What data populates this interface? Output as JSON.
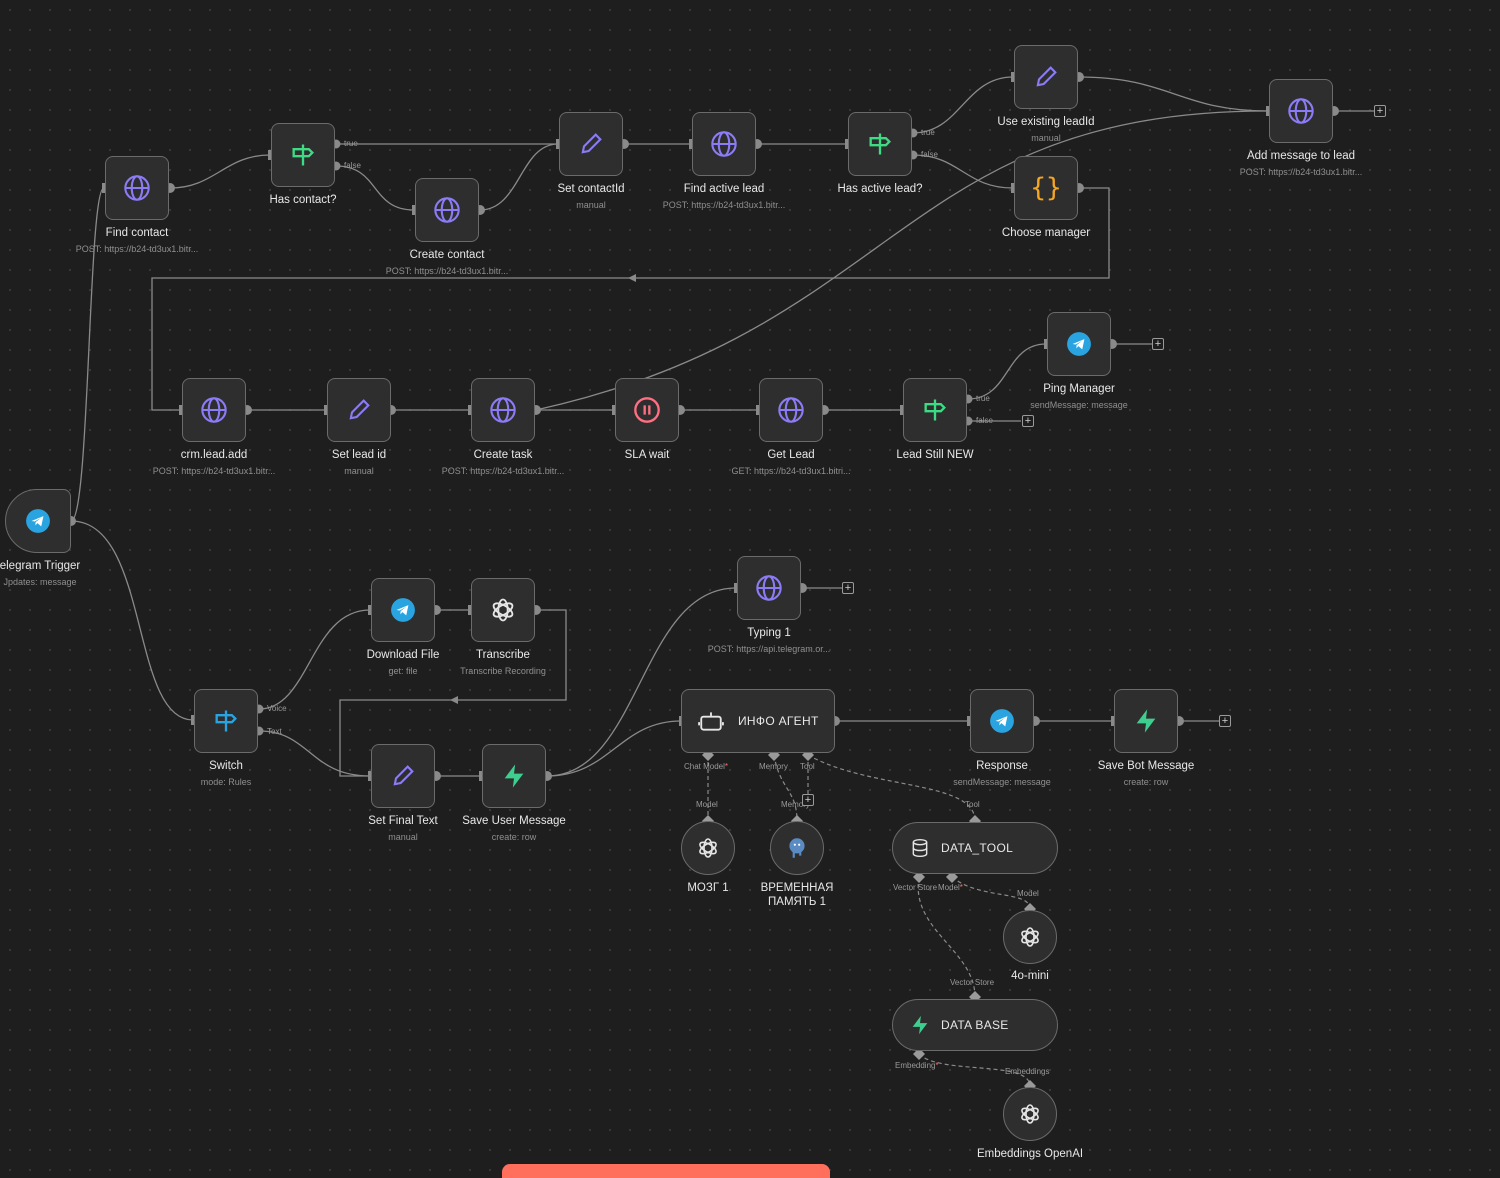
{
  "nodes": {
    "find_contact": {
      "label": "Find contact",
      "sub": "POST: https://b24-td3ux1.bitr...",
      "icon": "globe-icon"
    },
    "has_contact": {
      "label": "Has contact?",
      "icon": "signpost-icon"
    },
    "create_contact": {
      "label": "Create contact",
      "sub": "POST: https://b24-td3ux1.bitr...",
      "icon": "globe-icon"
    },
    "set_contact_id": {
      "label": "Set contactId",
      "sub": "manual",
      "icon": "pencil-icon"
    },
    "find_active_lead": {
      "label": "Find active lead",
      "sub": "POST: https://b24-td3ux1.bitr...",
      "icon": "globe-icon"
    },
    "has_active_lead": {
      "label": "Has active lead?",
      "icon": "signpost-icon"
    },
    "use_existing_lead": {
      "label": "Use existing leadId",
      "sub": "manual",
      "icon": "pencil-icon"
    },
    "choose_manager": {
      "label": "Choose manager",
      "icon": "braces-icon"
    },
    "add_message_lead": {
      "label": "Add message to lead",
      "sub": "POST: https://b24-td3ux1.bitr...",
      "icon": "globe-icon"
    },
    "crm_lead_add": {
      "label": "crm.lead.add",
      "sub": "POST: https://b24-td3ux1.bitr...",
      "icon": "globe-icon"
    },
    "set_lead_id": {
      "label": "Set lead id",
      "sub": "manual",
      "icon": "pencil-icon"
    },
    "create_task": {
      "label": "Create task",
      "sub": "POST: https://b24-td3ux1.bitr...",
      "icon": "globe-icon"
    },
    "sla_wait": {
      "label": "SLA wait",
      "icon": "pause-icon"
    },
    "get_lead": {
      "label": "Get Lead",
      "sub": "GET: https://b24-td3ux1.bitri...",
      "icon": "globe-icon"
    },
    "lead_still_new": {
      "label": "Lead Still NEW",
      "icon": "signpost-icon"
    },
    "ping_manager": {
      "label": "Ping Manager",
      "sub": "sendMessage: message",
      "icon": "telegram-icon"
    },
    "telegram_trigger": {
      "label": "elegram Trigger",
      "sub": "Jpdates: message",
      "icon": "telegram-icon"
    },
    "switch": {
      "label": "Switch",
      "sub": "mode: Rules",
      "icon": "signpost-icon"
    },
    "download_file": {
      "label": "Download File",
      "sub": "get: file",
      "icon": "telegram-icon"
    },
    "transcribe": {
      "label": "Transcribe",
      "sub": "Transcribe Recording",
      "icon": "openai-icon"
    },
    "set_final_text": {
      "label": "Set Final Text",
      "sub": "manual",
      "icon": "pencil-icon"
    },
    "save_user_message": {
      "label": "Save User Message",
      "sub": "create: row",
      "icon": "supabase-icon"
    },
    "typing": {
      "label": "Typing 1",
      "sub": "POST: https://api.telegram.or...",
      "icon": "globe-icon"
    },
    "info_agent": {
      "label": "ИНФО АГЕНТ",
      "icon": "robot-icon"
    },
    "response": {
      "label": "Response",
      "sub": "sendMessage: message",
      "icon": "telegram-icon"
    },
    "save_bot_message": {
      "label": "Save Bot Message",
      "sub": "create: row",
      "icon": "supabase-icon"
    },
    "brain": {
      "label": "МОЗГ 1",
      "icon": "openai-icon"
    },
    "memory": {
      "label": "ВРЕМЕННАЯ\nПАМЯТЬ 1",
      "icon": "postgres-icon"
    },
    "data_tool": {
      "label": "DATA_TOOL",
      "icon": "database-icon"
    },
    "mini": {
      "label": "4o-mini",
      "icon": "openai-icon"
    },
    "data_base": {
      "label": "DATA BASE",
      "icon": "supabase-icon"
    },
    "embeddings": {
      "label": "Embeddings OpenAI",
      "icon": "openai-icon"
    }
  },
  "ports": {
    "true": "true",
    "false": "false",
    "voice": "Voice",
    "text": "Text",
    "chat_model": "Chat Model",
    "required_mark": "*",
    "memory": "Memory",
    "tool": "Tool",
    "model": "Model",
    "vector_store": "Vector Store",
    "embedding": "Embedding",
    "embeddings": "Embeddings"
  },
  "controls": {
    "add": "+"
  },
  "colors": {
    "canvas": "#1e1e1e",
    "node_bg": "#2e2e2e",
    "node_border": "#6b6b6b",
    "edge": "#8a8a8a",
    "globe": "#8b7cf6",
    "signpost": "#3ddc84",
    "telegram": "#2aa4e0",
    "braces": "#f5a623",
    "pause": "#ff6f83",
    "supabase": "#3ecf8e",
    "accent_bar": "#ff6f5c"
  }
}
